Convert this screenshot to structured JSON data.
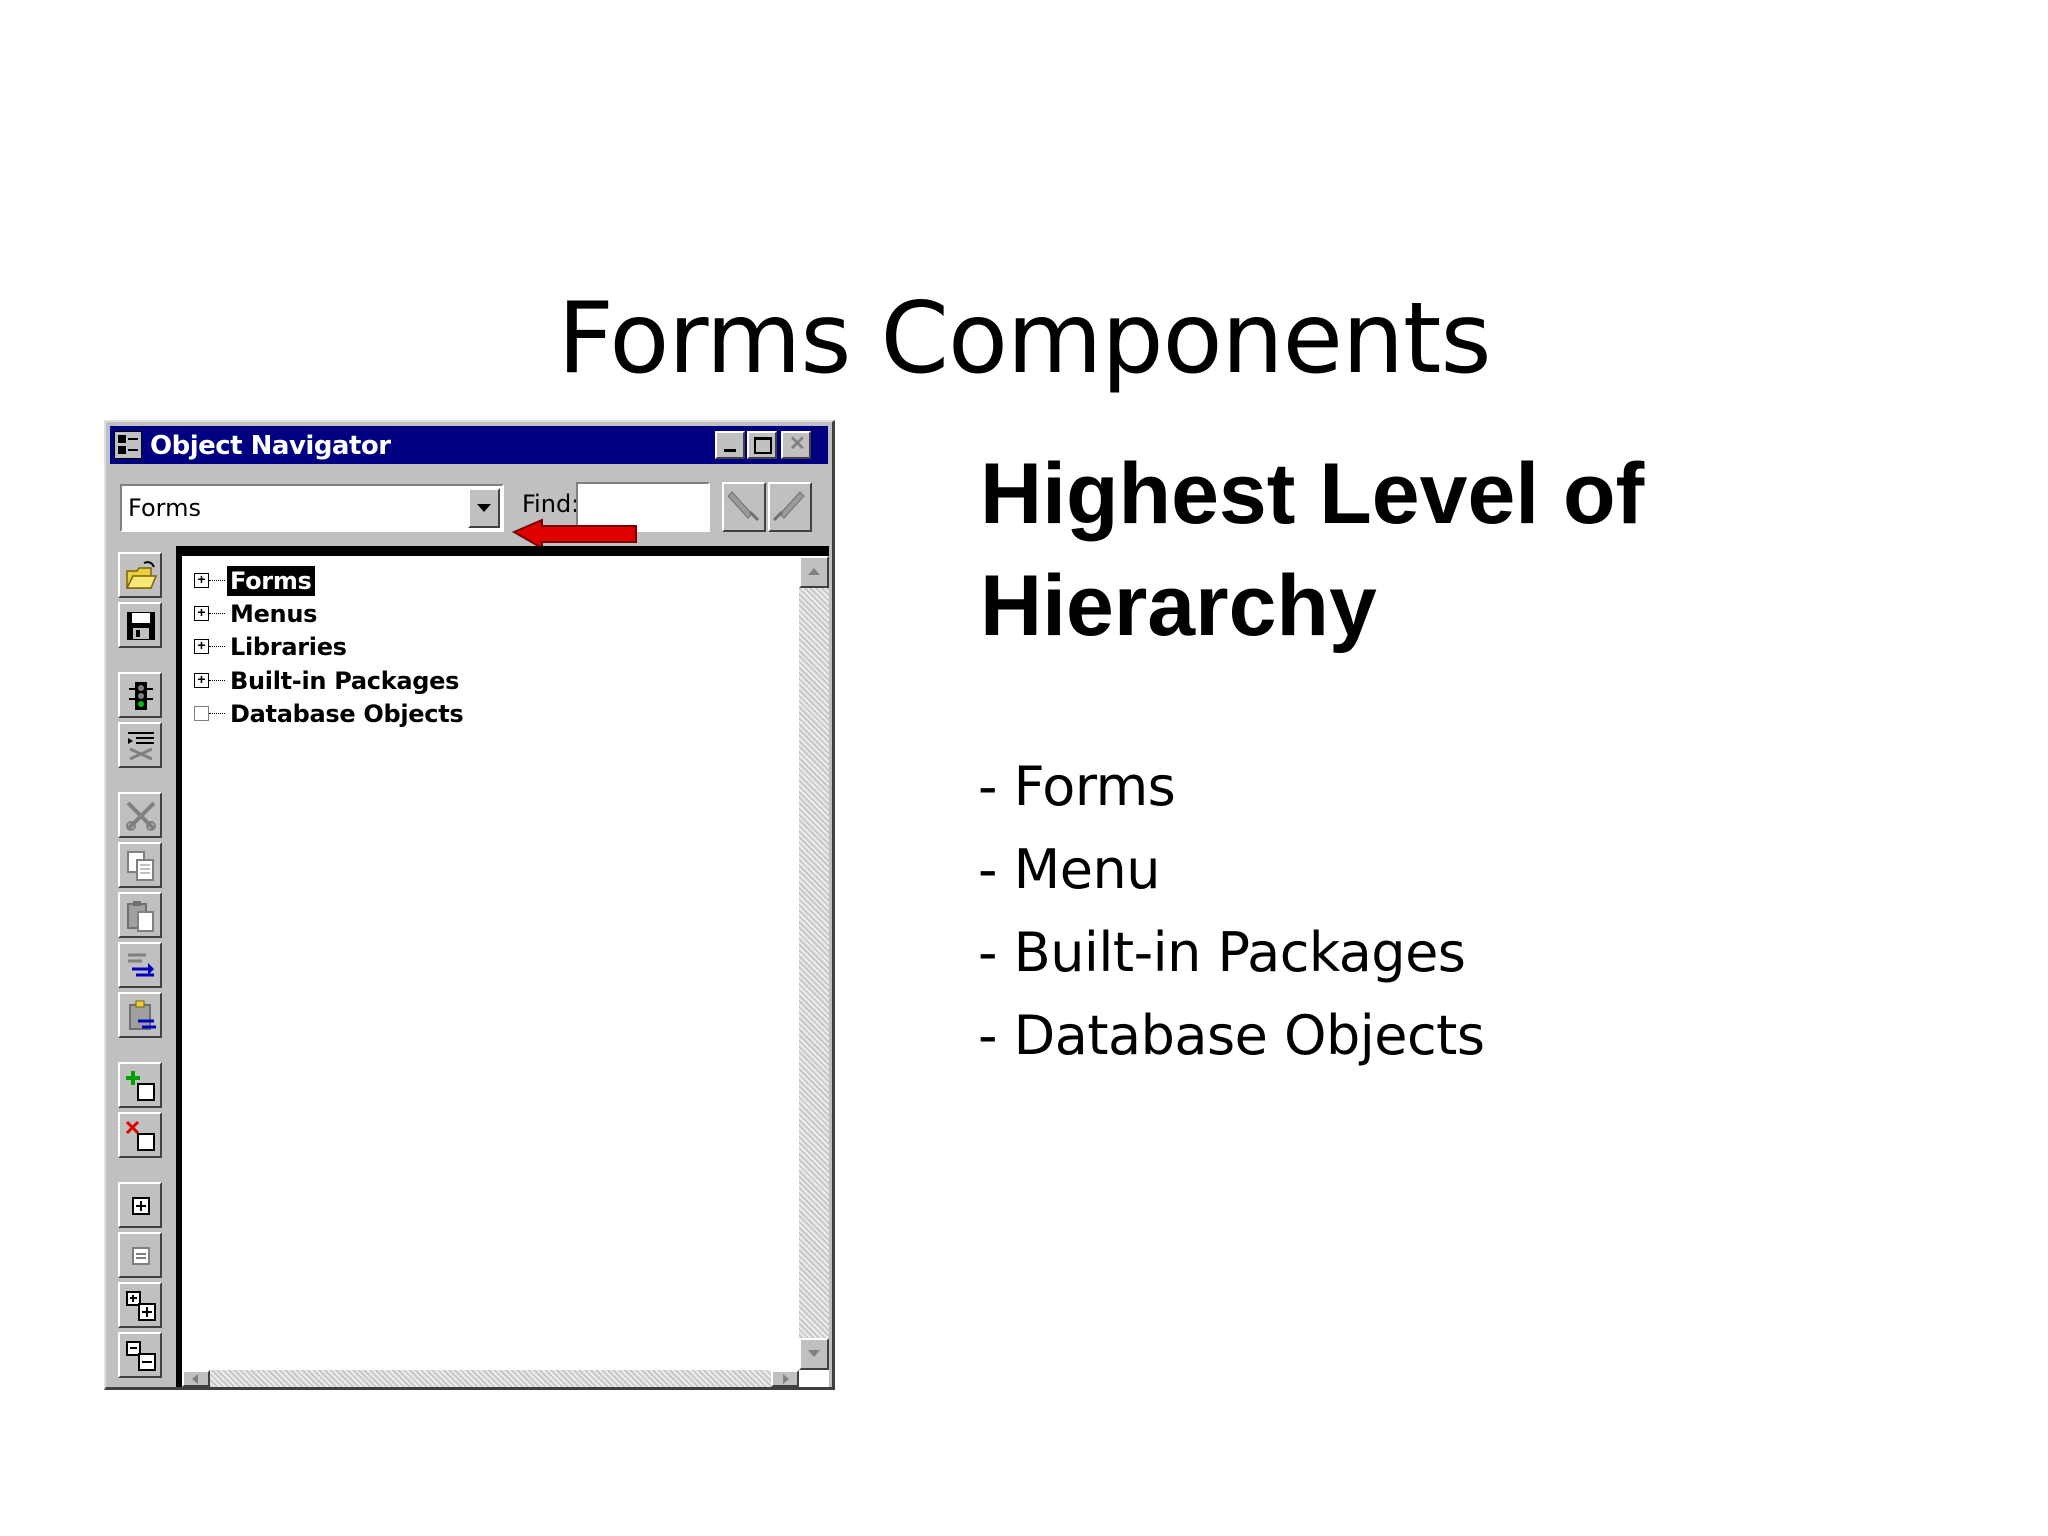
{
  "slide": {
    "title": "Forms Components",
    "heading": "Highest Level of Hierarchy",
    "bullets": [
      "- Forms",
      "- Menu",
      "- Built-in Packages",
      "- Database Objects"
    ]
  },
  "window": {
    "title": "Object Navigator",
    "controls": [
      "minimize-icon",
      "maximize-icon",
      "close-icon"
    ],
    "combo_value": "Forms",
    "find_label": "Find:",
    "find_value": "",
    "tree": [
      {
        "label": "Forms",
        "expander": "+",
        "selected": true
      },
      {
        "label": "Menus",
        "expander": "+",
        "selected": false
      },
      {
        "label": "Libraries",
        "expander": "+",
        "selected": false
      },
      {
        "label": "Built-in Packages",
        "expander": "+",
        "selected": false
      },
      {
        "label": "Database Objects",
        "expander": "",
        "selected": false
      }
    ],
    "toolbar_icons": [
      "open-icon",
      "save-icon",
      "run-icon",
      "debug-icon",
      "cut-icon",
      "copy-icon",
      "paste-icon",
      "copy-properties-icon",
      "paste-properties-icon",
      "create-icon",
      "delete-icon",
      "expand-icon",
      "collapse-icon",
      "expand-all-icon",
      "collapse-all-icon"
    ]
  },
  "colors": {
    "titlebar": "#000080",
    "annotation_arrow": "#e00000"
  }
}
